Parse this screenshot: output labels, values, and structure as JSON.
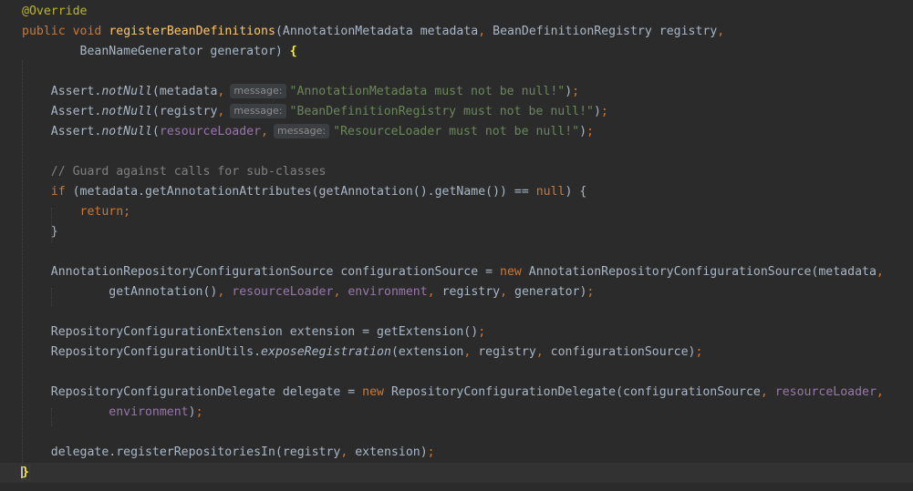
{
  "lines": [
    [
      {
        "t": "@Override",
        "c": "ann"
      }
    ],
    [
      {
        "t": "public",
        "c": "kw"
      },
      {
        "t": " "
      },
      {
        "t": "void",
        "c": "kw"
      },
      {
        "t": " "
      },
      {
        "t": "registerBeanDefinitions",
        "c": "fn"
      },
      {
        "t": "(AnnotationMetadata metadata"
      },
      {
        "t": ",",
        "c": "kw"
      },
      {
        "t": " BeanDefinitionRegistry registry"
      },
      {
        "t": ",",
        "c": "kw"
      }
    ],
    [
      {
        "t": "        BeanNameGenerator generator) "
      },
      {
        "t": "{",
        "c": "brace-match"
      }
    ],
    [],
    [
      {
        "t": "    Assert."
      },
      {
        "t": "notNull",
        "c": "it"
      },
      {
        "t": "(metadata"
      },
      {
        "t": ",",
        "c": "kw"
      },
      {
        "hint": "message:"
      },
      {
        "t": "\"AnnotationMetadata must not be null!\"",
        "c": "str"
      },
      {
        "t": ")"
      },
      {
        "t": ";",
        "c": "kw"
      }
    ],
    [
      {
        "t": "    Assert."
      },
      {
        "t": "notNull",
        "c": "it"
      },
      {
        "t": "(registry"
      },
      {
        "t": ",",
        "c": "kw"
      },
      {
        "hint": "message:"
      },
      {
        "t": "\"BeanDefinitionRegistry must not be null!\"",
        "c": "str"
      },
      {
        "t": ")"
      },
      {
        "t": ";",
        "c": "kw"
      }
    ],
    [
      {
        "t": "    Assert."
      },
      {
        "t": "notNull",
        "c": "it"
      },
      {
        "t": "("
      },
      {
        "t": "resourceLoader",
        "c": "fld"
      },
      {
        "t": ",",
        "c": "kw"
      },
      {
        "hint": "message:"
      },
      {
        "t": "\"ResourceLoader must not be null!\"",
        "c": "str"
      },
      {
        "t": ")"
      },
      {
        "t": ";",
        "c": "kw"
      }
    ],
    [],
    [
      {
        "t": "    // Guard against calls for sub-classes",
        "c": "cmt"
      }
    ],
    [
      {
        "t": "    "
      },
      {
        "t": "if",
        "c": "kw"
      },
      {
        "t": " (metadata.getAnnotationAttributes(getAnnotation().getName()) == "
      },
      {
        "t": "null",
        "c": "kw"
      },
      {
        "t": ") {"
      }
    ],
    [
      {
        "t": "        "
      },
      {
        "t": "return",
        "c": "kw"
      },
      {
        "t": ";",
        "c": "kw"
      }
    ],
    [
      {
        "t": "    }"
      }
    ],
    [],
    [
      {
        "t": "    AnnotationRepositoryConfigurationSource configurationSource = "
      },
      {
        "t": "new",
        "c": "kw"
      },
      {
        "t": " AnnotationRepositoryConfigurationSource(metadata"
      },
      {
        "t": ",",
        "c": "kw"
      }
    ],
    [
      {
        "t": "            getAnnotation()"
      },
      {
        "t": ",",
        "c": "kw"
      },
      {
        "t": " "
      },
      {
        "t": "resourceLoader",
        "c": "fld"
      },
      {
        "t": ",",
        "c": "kw"
      },
      {
        "t": " "
      },
      {
        "t": "environment",
        "c": "fld"
      },
      {
        "t": ",",
        "c": "kw"
      },
      {
        "t": " registry"
      },
      {
        "t": ",",
        "c": "kw"
      },
      {
        "t": " generator)"
      },
      {
        "t": ";",
        "c": "kw"
      }
    ],
    [],
    [
      {
        "t": "    RepositoryConfigurationExtension extension = getExtension()"
      },
      {
        "t": ";",
        "c": "kw"
      }
    ],
    [
      {
        "t": "    RepositoryConfigurationUtils."
      },
      {
        "t": "exposeRegistration",
        "c": "it"
      },
      {
        "t": "(extension"
      },
      {
        "t": ",",
        "c": "kw"
      },
      {
        "t": " registry"
      },
      {
        "t": ",",
        "c": "kw"
      },
      {
        "t": " configurationSource)"
      },
      {
        "t": ";",
        "c": "kw"
      }
    ],
    [],
    [
      {
        "t": "    RepositoryConfigurationDelegate delegate = "
      },
      {
        "t": "new",
        "c": "kw"
      },
      {
        "t": " RepositoryConfigurationDelegate(configurationSource"
      },
      {
        "t": ",",
        "c": "kw"
      },
      {
        "t": " "
      },
      {
        "t": "resourceLoader",
        "c": "fld"
      },
      {
        "t": ",",
        "c": "kw"
      }
    ],
    [
      {
        "t": "            "
      },
      {
        "t": "environment",
        "c": "fld"
      },
      {
        "t": ")"
      },
      {
        "t": ";",
        "c": "kw"
      }
    ],
    [],
    [
      {
        "t": "    delegate.registerRepositoriesIn(registry"
      },
      {
        "t": ",",
        "c": "kw"
      },
      {
        "t": " extension)"
      },
      {
        "t": ";",
        "c": "kw"
      }
    ],
    [
      {
        "t": "}",
        "c": "caret-brace"
      }
    ]
  ]
}
